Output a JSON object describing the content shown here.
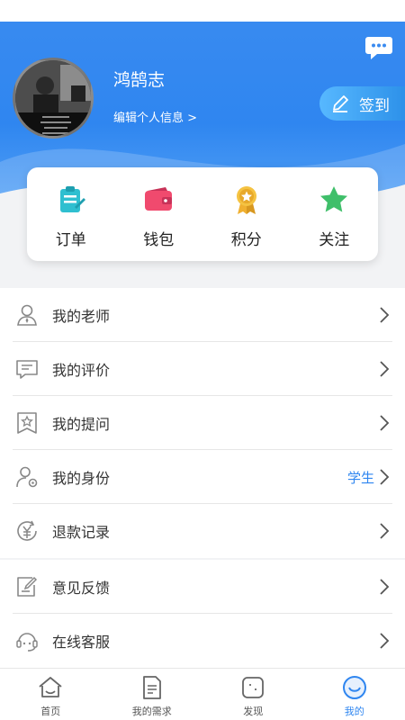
{
  "header": {
    "username": "鸿鹄志",
    "edit_profile": "编辑个人信息 >",
    "checkin_label": "签到"
  },
  "shortcuts": [
    {
      "label": "订单",
      "icon": "clipboard-icon",
      "color": "#2fbfd0"
    },
    {
      "label": "钱包",
      "icon": "wallet-icon",
      "color": "#f04a6e"
    },
    {
      "label": "积分",
      "icon": "medal-icon",
      "color": "#f0b030"
    },
    {
      "label": "关注",
      "icon": "star-icon",
      "color": "#3fbf6a"
    }
  ],
  "menu": [
    {
      "label": "我的老师",
      "icon": "teacher-icon",
      "value": ""
    },
    {
      "label": "我的评价",
      "icon": "comment-icon",
      "value": ""
    },
    {
      "label": "我的提问",
      "icon": "question-icon",
      "value": ""
    },
    {
      "label": "我的身份",
      "icon": "identity-icon",
      "value": "学生"
    },
    {
      "label": "退款记录",
      "icon": "refund-icon",
      "value": ""
    }
  ],
  "menu2": [
    {
      "label": "意见反馈",
      "icon": "feedback-icon"
    },
    {
      "label": "在线客服",
      "icon": "customer-service-icon"
    }
  ],
  "tabs": [
    {
      "label": "首页",
      "icon": "home-icon",
      "active": false
    },
    {
      "label": "我的需求",
      "icon": "document-icon",
      "active": false
    },
    {
      "label": "发现",
      "icon": "discover-icon",
      "active": false
    },
    {
      "label": "我的",
      "icon": "profile-icon",
      "active": true
    }
  ],
  "colors": {
    "primary": "#2f86f0",
    "header_light": "#5aa6f6"
  }
}
